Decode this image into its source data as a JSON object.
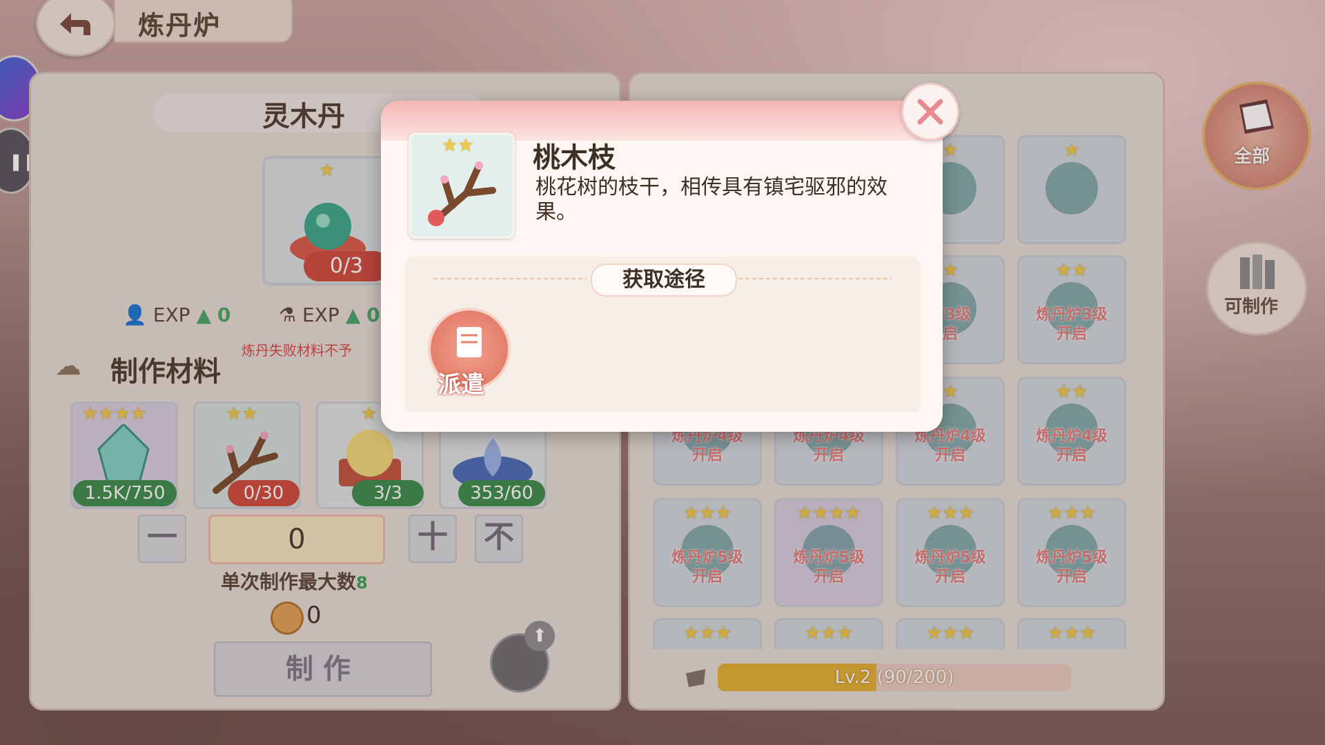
{
  "header": {
    "title": "炼丹炉",
    "back_icon": "back-arrow-icon"
  },
  "left_panel": {
    "product": {
      "name": "灵木丹",
      "stars": 1,
      "count": "0/3"
    },
    "exp": [
      {
        "icon": "player-icon",
        "label": "EXP",
        "value": "0"
      },
      {
        "icon": "furnace-icon",
        "label": "EXP",
        "value": "0"
      }
    ],
    "fail_note": "炼丹失败材料不予",
    "materials_title": "制作材料",
    "materials": [
      {
        "name": "crystal",
        "stars": 4,
        "count": "1.5K/750",
        "status": "green"
      },
      {
        "name": "peach-branch",
        "stars": 2,
        "count": "0/30",
        "status": "red"
      },
      {
        "name": "golden-egg",
        "stars": 1,
        "count": "3/3",
        "status": "green"
      },
      {
        "name": "lotus",
        "stars": 0,
        "count": "353/60",
        "status": "green"
      }
    ],
    "minus_label": "一",
    "plus_label": "十",
    "max_btn_label": "不",
    "quantity": "0",
    "max_label": "单次制作最大数",
    "max_value": "8",
    "coin_value": "0",
    "make_label": "制作"
  },
  "right_panel": {
    "rows": [
      [
        {
          "locked": "",
          "stars": 1
        },
        {
          "locked": "",
          "stars": 1
        }
      ],
      [
        {
          "locked": "炉3级\n启",
          "stars": 1
        },
        {
          "locked": "炼丹炉3级\n开启",
          "stars": 2
        }
      ],
      [
        {
          "locked": "炼丹炉4级\n开启",
          "stars": 0
        },
        {
          "locked": "炼丹炉4级\n开启",
          "stars": 0
        },
        {
          "locked": "炼丹炉4级\n开启",
          "stars": 1
        },
        {
          "locked": "炼丹炉4级\n开启",
          "stars": 2
        }
      ],
      [
        {
          "locked": "炼丹炉5级\n开启",
          "stars": 3
        },
        {
          "locked": "炼丹炉5级\n开启",
          "stars": 4
        },
        {
          "locked": "炼丹炉5级\n开启",
          "stars": 3
        },
        {
          "locked": "炼丹炉5级\n开启",
          "stars": 3
        }
      ]
    ],
    "level": {
      "text": "Lv.2 (90/200)",
      "progress": 0.45
    }
  },
  "filters": {
    "all_label": "全部",
    "craftable_label": "可制作"
  },
  "popup": {
    "item_name": "桃木枝",
    "item_stars": 2,
    "description": "桃花树的枝干，相传具有镇宅驱邪的效果。",
    "source_title": "获取途径",
    "source_label": "派遣"
  }
}
